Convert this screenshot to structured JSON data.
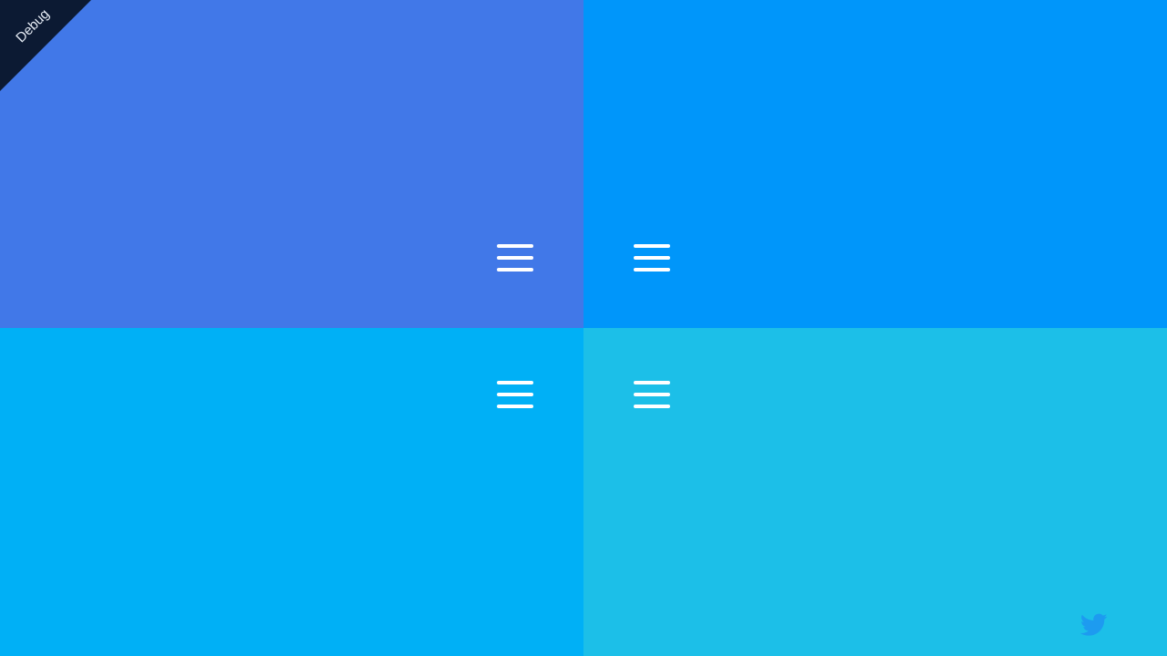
{
  "debug_banner": {
    "label": "Debug",
    "color": "#0c1a33"
  },
  "quadrants": [
    {
      "name": "top-left",
      "color": "#4178e8"
    },
    {
      "name": "top-right",
      "color": "#0096fa"
    },
    {
      "name": "bottom-left",
      "color": "#00b0f6"
    },
    {
      "name": "bottom-right",
      "color": "#1cbfe8"
    }
  ],
  "icons": {
    "menu": "hamburger-menu-icon",
    "brand": "twitter-bird-icon",
    "brand_color": "#1d9bf0"
  }
}
